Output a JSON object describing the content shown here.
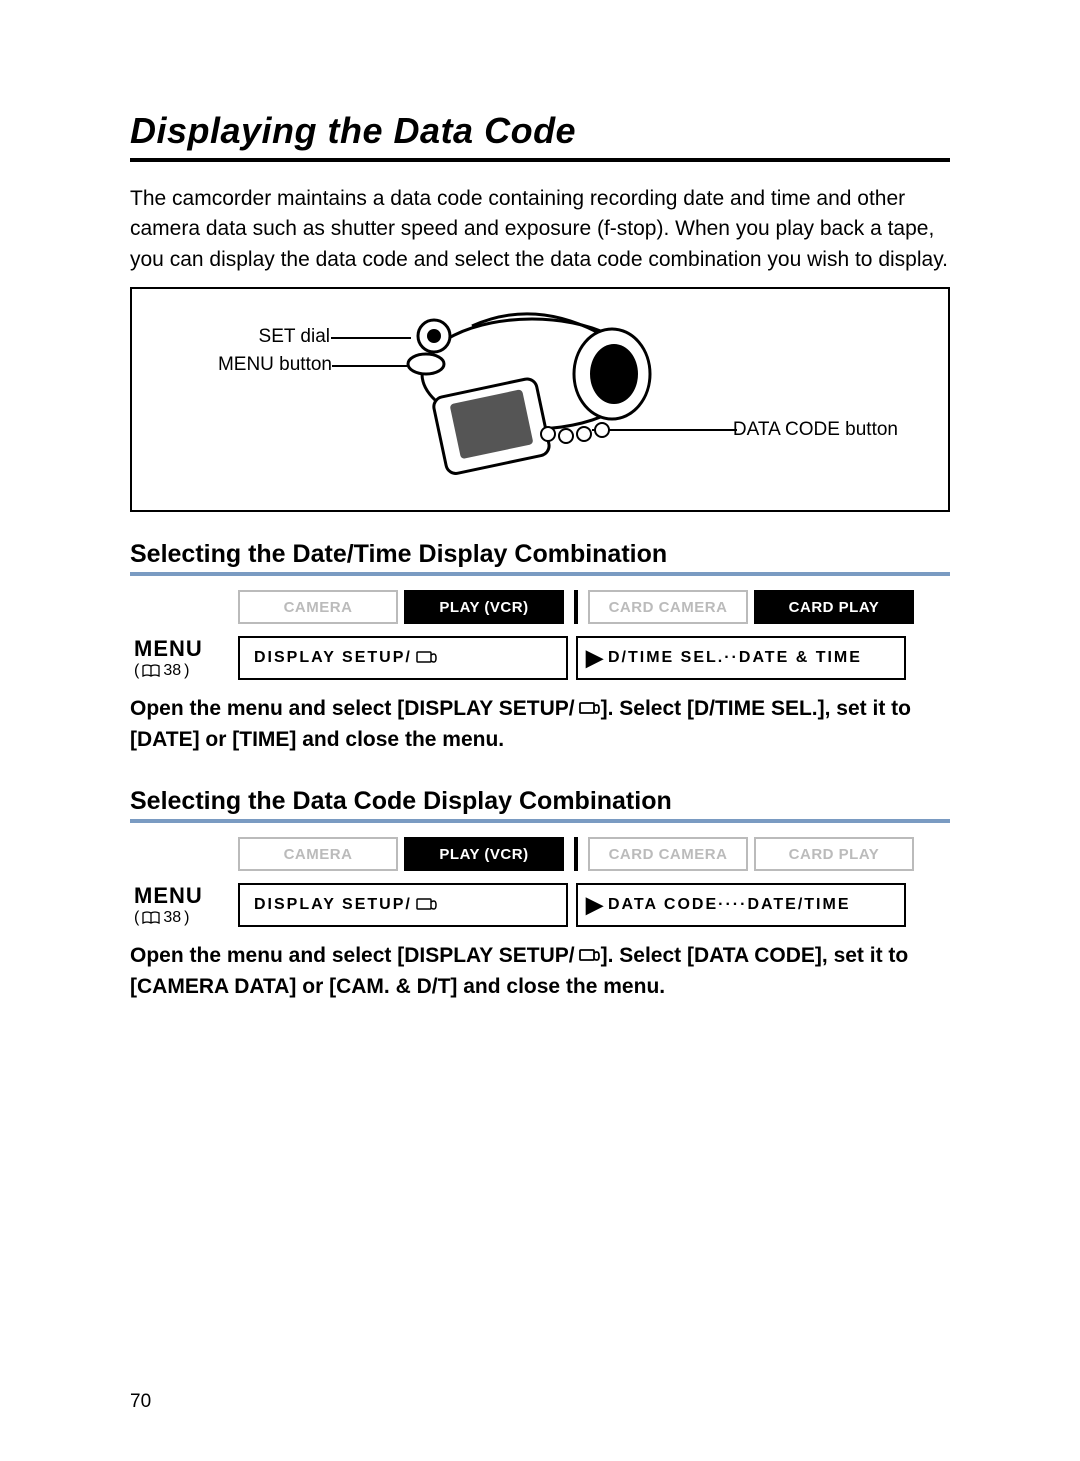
{
  "page": {
    "title": "Displaying the Data Code",
    "intro": "The camcorder maintains a data code containing recording date and time and other camera data such as shutter speed and exposure (f-stop). When you play back a tape, you can display the data code and select the data code combination you wish to display.",
    "page_number": "70"
  },
  "diagram": {
    "set_dial": "SET dial",
    "menu_button": "MENU button",
    "data_code_button": "DATA CODE button"
  },
  "section1": {
    "heading": "Selecting the Date/Time Display Combination",
    "modes": {
      "camera": "CAMERA",
      "play_vcr": "PLAY (VCR)",
      "card_camera": "CARD CAMERA",
      "card_play": "CARD PLAY"
    },
    "menu_word": "MENU",
    "menu_ref": "38",
    "setting_left": "DISPLAY SETUP/",
    "setting_right": "D/TIME SEL.··DATE & TIME",
    "instruction_a": "Open the menu and select [DISPLAY SETUP/",
    "instruction_b": "]. Select [D/TIME SEL.], set it to [DATE] or [TIME] and close the menu."
  },
  "section2": {
    "heading": "Selecting the Data Code Display Combination",
    "modes": {
      "camera": "CAMERA",
      "play_vcr": "PLAY (VCR)",
      "card_camera": "CARD CAMERA",
      "card_play": "CARD PLAY"
    },
    "menu_word": "MENU",
    "menu_ref": "38",
    "setting_left": "DISPLAY SETUP/",
    "setting_right": "DATA CODE····DATE/TIME",
    "instruction_a": "Open the menu and select [DISPLAY SETUP/",
    "instruction_b": "]. Select [DATA CODE], set it to [CAMERA DATA] or [CAM. & D/T] and close the menu."
  }
}
